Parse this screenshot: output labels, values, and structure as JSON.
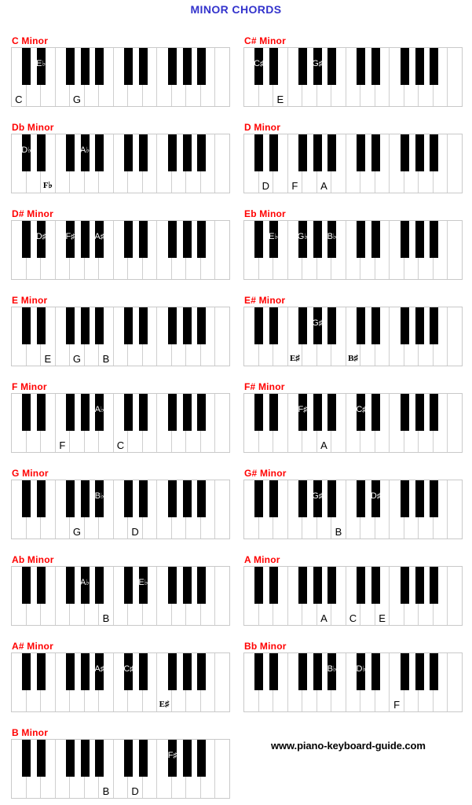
{
  "page": {
    "title": "MINOR CHORDS",
    "title_color": "#3333cc",
    "chord_title_color": "#ff0000",
    "footer": "www.piano-keyboard-guide.com"
  },
  "keyboard": {
    "white_keys": [
      "C",
      "D",
      "E",
      "F",
      "G",
      "A",
      "B",
      "C",
      "D",
      "E",
      "F",
      "G",
      "A",
      "B",
      "C"
    ],
    "black_key_after_white_index": [
      0,
      1,
      3,
      4,
      5,
      7,
      8,
      10,
      11,
      12
    ],
    "white_key_count": 15,
    "black_key_count": 10
  },
  "chords": [
    {
      "name": "C Minor",
      "notes": [
        "C",
        "E♭",
        "G"
      ],
      "keys": [
        {
          "label": "C",
          "type": "white",
          "index": 0
        },
        {
          "label": "E",
          "accidental": "♭",
          "type": "black",
          "index": 1
        },
        {
          "label": "G",
          "type": "white",
          "index": 4
        }
      ]
    },
    {
      "name": "C# Minor",
      "notes": [
        "C♯",
        "E",
        "G♯"
      ],
      "keys": [
        {
          "label": "C",
          "accidental": "♯",
          "type": "black",
          "index": 0
        },
        {
          "label": "E",
          "type": "white",
          "index": 2
        },
        {
          "label": "G",
          "accidental": "♯",
          "type": "black",
          "index": 4
        }
      ]
    },
    {
      "name": "Db Minor",
      "notes": [
        "D♭",
        "F♭",
        "A♭"
      ],
      "keys": [
        {
          "label": "D",
          "accidental": "♭",
          "type": "black",
          "index": 0
        },
        {
          "label": "F",
          "accidental": "♭",
          "type": "white",
          "index": 2,
          "style": "serifbold"
        },
        {
          "label": "A",
          "accidental": "♭",
          "type": "black",
          "index": 4
        }
      ]
    },
    {
      "name": "D Minor",
      "notes": [
        "D",
        "F",
        "A"
      ],
      "keys": [
        {
          "label": "D",
          "type": "white",
          "index": 1
        },
        {
          "label": "F",
          "type": "white",
          "index": 3
        },
        {
          "label": "A",
          "type": "white",
          "index": 5
        }
      ]
    },
    {
      "name": "D# Minor",
      "notes": [
        "D♯",
        "F♯",
        "A♯"
      ],
      "keys": [
        {
          "label": "D",
          "accidental": "♯",
          "type": "black",
          "index": 1
        },
        {
          "label": "F",
          "accidental": "♯",
          "type": "black",
          "index": 3
        },
        {
          "label": "A",
          "accidental": "♯",
          "type": "black",
          "index": 5
        }
      ]
    },
    {
      "name": "Eb Minor",
      "notes": [
        "E♭",
        "G♭",
        "B♭"
      ],
      "keys": [
        {
          "label": "E",
          "accidental": "♭",
          "type": "black",
          "index": 1
        },
        {
          "label": "G",
          "accidental": "♭",
          "type": "black",
          "index": 3
        },
        {
          "label": "B",
          "accidental": "♭",
          "type": "black",
          "index": 5
        }
      ]
    },
    {
      "name": "E Minor",
      "notes": [
        "E",
        "G",
        "B"
      ],
      "keys": [
        {
          "label": "E",
          "type": "white",
          "index": 2
        },
        {
          "label": "G",
          "type": "white",
          "index": 4
        },
        {
          "label": "B",
          "type": "white",
          "index": 6
        }
      ]
    },
    {
      "name": "E# Minor",
      "notes": [
        "E♯",
        "G♯",
        "B♯"
      ],
      "keys": [
        {
          "label": "E",
          "accidental": "♯",
          "type": "white",
          "index": 3,
          "style": "serifbold"
        },
        {
          "label": "G",
          "accidental": "♯",
          "type": "black",
          "index": 4
        },
        {
          "label": "B",
          "accidental": "♯",
          "type": "white",
          "index": 7,
          "style": "serifbold"
        }
      ]
    },
    {
      "name": "F Minor",
      "notes": [
        "F",
        "A♭",
        "C"
      ],
      "keys": [
        {
          "label": "F",
          "type": "white",
          "index": 3
        },
        {
          "label": "A",
          "accidental": "♭",
          "type": "black",
          "index": 5
        },
        {
          "label": "C",
          "type": "white",
          "index": 7
        }
      ]
    },
    {
      "name": "F# Minor",
      "notes": [
        "F♯",
        "A",
        "C♯"
      ],
      "keys": [
        {
          "label": "F",
          "accidental": "♯",
          "type": "black",
          "index": 3
        },
        {
          "label": "A",
          "type": "white",
          "index": 5
        },
        {
          "label": "C",
          "accidental": "♯",
          "type": "black",
          "index": 7
        }
      ]
    },
    {
      "name": "G Minor",
      "notes": [
        "G",
        "B♭",
        "D"
      ],
      "keys": [
        {
          "label": "G",
          "type": "white",
          "index": 4
        },
        {
          "label": "B",
          "accidental": "♭",
          "type": "black",
          "index": 5
        },
        {
          "label": "D",
          "type": "white",
          "index": 8
        }
      ]
    },
    {
      "name": "G# Minor",
      "notes": [
        "G♯",
        "B",
        "D♯"
      ],
      "keys": [
        {
          "label": "G",
          "accidental": "♯",
          "type": "black",
          "index": 4
        },
        {
          "label": "B",
          "type": "white",
          "index": 6
        },
        {
          "label": "D",
          "accidental": "♯",
          "type": "black",
          "index": 8
        }
      ]
    },
    {
      "name": "Ab Minor",
      "notes": [
        "A♭",
        "B",
        "E♭"
      ],
      "keys": [
        {
          "label": "A",
          "accidental": "♭",
          "type": "black",
          "index": 4
        },
        {
          "label": "B",
          "type": "white",
          "index": 6
        },
        {
          "label": "E",
          "accidental": "♭",
          "type": "black",
          "index": 8
        }
      ]
    },
    {
      "name": "A Minor",
      "notes": [
        "A",
        "C",
        "E"
      ],
      "keys": [
        {
          "label": "A",
          "type": "white",
          "index": 5
        },
        {
          "label": "C",
          "type": "white",
          "index": 7
        },
        {
          "label": "E",
          "type": "white",
          "index": 9
        }
      ]
    },
    {
      "name": "A# Minor",
      "notes": [
        "A♯",
        "C♯",
        "E♯"
      ],
      "keys": [
        {
          "label": "A",
          "accidental": "♯",
          "type": "black",
          "index": 5
        },
        {
          "label": "C",
          "accidental": "♯",
          "type": "black",
          "index": 7
        },
        {
          "label": "E",
          "accidental": "♯",
          "type": "white",
          "index": 10,
          "style": "serifbold"
        }
      ]
    },
    {
      "name": "Bb Minor",
      "notes": [
        "B♭",
        "D♭",
        "F"
      ],
      "keys": [
        {
          "label": "B",
          "accidental": "♭",
          "type": "black",
          "index": 5
        },
        {
          "label": "D",
          "accidental": "♭",
          "type": "black",
          "index": 7
        },
        {
          "label": "F",
          "type": "white",
          "index": 10
        }
      ]
    },
    {
      "name": "B Minor",
      "notes": [
        "B",
        "D",
        "F♯"
      ],
      "keys": [
        {
          "label": "B",
          "type": "white",
          "index": 6
        },
        {
          "label": "D",
          "type": "white",
          "index": 8
        },
        {
          "label": "F",
          "accidental": "♯",
          "type": "black",
          "index": 10
        }
      ]
    }
  ]
}
